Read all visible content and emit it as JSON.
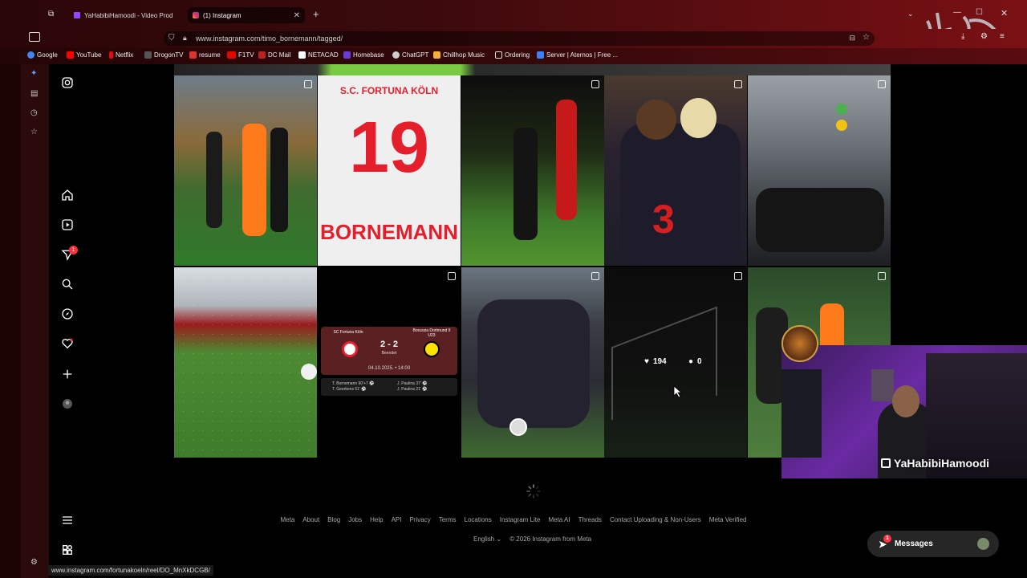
{
  "browser": {
    "tabs": [
      {
        "title": "YaHabibiHamoodi - Video Prod",
        "active": false
      },
      {
        "title": "(1) Instagram",
        "active": true
      }
    ],
    "new_tab": "+",
    "url": "www.instagram.com/timo_bornemann/tagged/",
    "bookmarks": [
      {
        "label": "Google",
        "color": "#4285f4"
      },
      {
        "label": "YouTube",
        "color": "#ff0000"
      },
      {
        "label": "Netflix",
        "color": "#e50914"
      },
      {
        "label": "DrogonTV",
        "color": "#333333"
      },
      {
        "label": "resume",
        "color": "#d33"
      },
      {
        "label": "F1TV",
        "color": "#e10600"
      },
      {
        "label": "DC Mail",
        "color": "#b22"
      },
      {
        "label": "NETACAD",
        "color": "#ffffff"
      },
      {
        "label": "Homebase",
        "color": "#6a3bd6"
      },
      {
        "label": "ChatGPT",
        "color": "#cccccc"
      },
      {
        "label": "Chillhop Music",
        "color": "#f2b233"
      },
      {
        "label": "Ordering",
        "color": "#dddddd"
      },
      {
        "label": "Server | Aternos | Free ...",
        "color": "#3b82f6"
      }
    ],
    "status_url": "www.instagram.com/fortunakoeln/reel/DO_MnXkDCGB/"
  },
  "instagram": {
    "nav_icons": [
      "instagram-icon",
      "home-icon",
      "reels-icon",
      "direct-icon",
      "search-icon",
      "explore-icon",
      "notifications-icon",
      "create-icon",
      "profile-avatar",
      "more-menu-icon",
      "also-from-meta-icon"
    ],
    "direct_badge": "1",
    "hover_overlay": {
      "likes": "194",
      "comments": "0"
    },
    "scoreboard": {
      "home": "SC Fortuna Köln",
      "away": "Borussia Dortmund II U23",
      "score": "2 - 2",
      "status": "Beendet",
      "date": "04.10.2025. • 14:00",
      "home_scorers": "T. Bornemann 90'+7 ⚽\nT. Geerkens 51' ⚽",
      "away_scorers": "J. Paulina 37' ⚽\nJ. Paulina 21' ⚽"
    },
    "jersey_text": {
      "club": "S.C. FORTUNA KÖLN",
      "number": "19",
      "name": "BORNEMANN"
    },
    "footer": {
      "links": [
        "Meta",
        "About",
        "Blog",
        "Jobs",
        "Help",
        "API",
        "Privacy",
        "Terms",
        "Locations",
        "Instagram Lite",
        "Meta AI",
        "Threads",
        "Contact Uploading & Non-Users",
        "Meta Verified"
      ],
      "language": "English",
      "copyright": "© 2026 Instagram from Meta"
    },
    "messages_label": "Messages",
    "messages_badge": "1"
  },
  "webcam": {
    "streamer": "YaHabibiHamoodi"
  }
}
